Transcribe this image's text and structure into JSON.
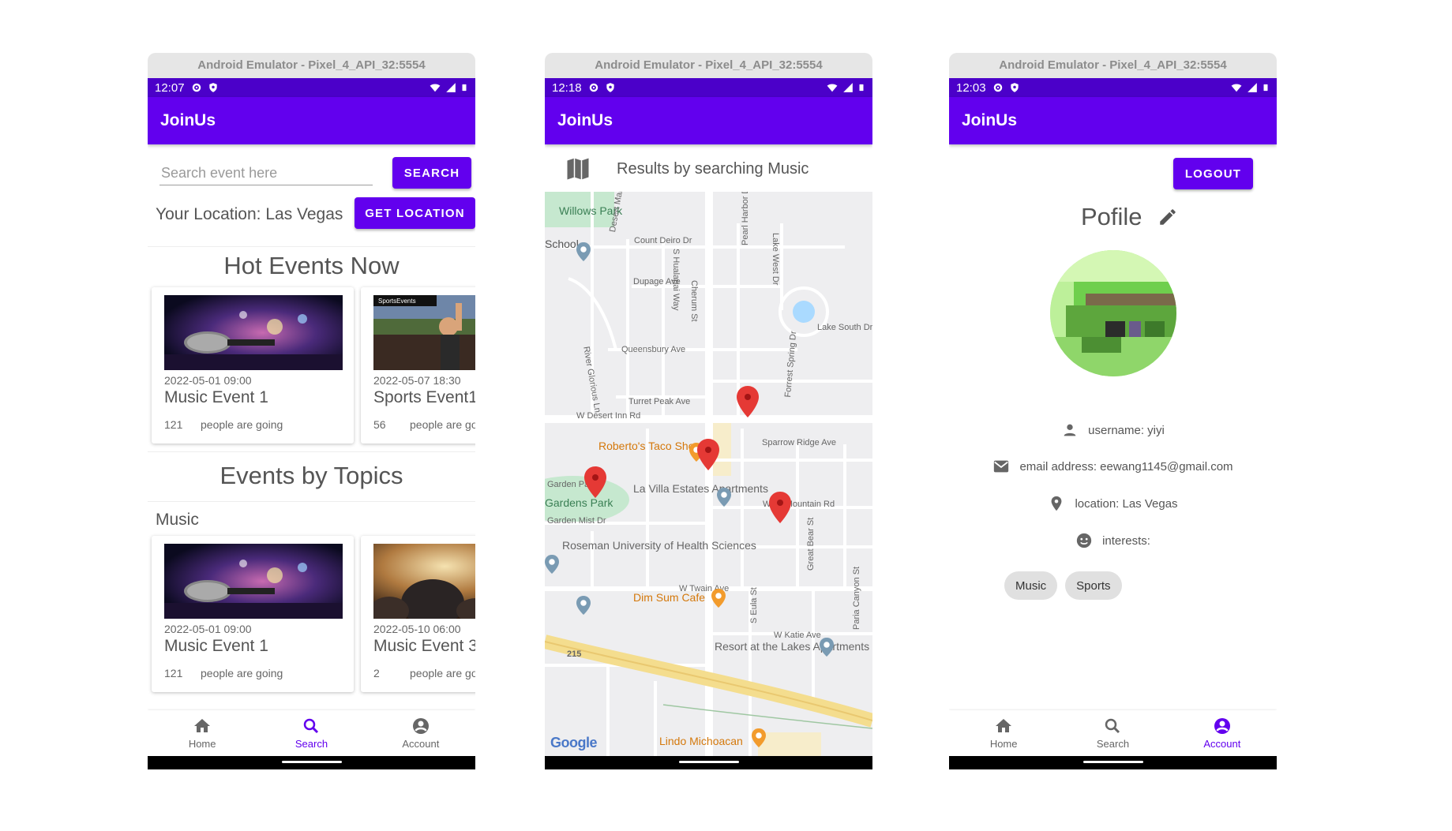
{
  "emulator_title": "Android Emulator - Pixel_4_API_32:5554",
  "app_name": "JoinUs",
  "colors": {
    "primary": "#6200ee",
    "status_bar": "#4b00c9",
    "pin": "#e53935"
  },
  "phone1": {
    "status_time": "12:07",
    "search": {
      "placeholder": "Search event here",
      "button": "SEARCH"
    },
    "location": {
      "text": "Your Location: Las Vegas",
      "button": "GET LOCATION"
    },
    "hot_title": "Hot Events Now",
    "hot_events": [
      {
        "date": "2022-05-01 09:00",
        "name": "Music Event 1",
        "count": "121",
        "going": "people are going",
        "image": "microphone-stage-image"
      },
      {
        "date": "2022-05-07 18:30",
        "name": "Sports Event1",
        "count": "56",
        "going": "people are going",
        "image": "stadium-crowd-image"
      }
    ],
    "topics_title": "Events by Topics",
    "topic_name": "Music",
    "topic_events": [
      {
        "date": "2022-05-01 09:00",
        "name": "Music Event 1",
        "count": "121",
        "going": "people are going",
        "image": "microphone-stage-image"
      },
      {
        "date": "2022-05-10 06:00",
        "name": "Music Event 3",
        "count": "2",
        "going": "people are going",
        "image": "concert-crowd-image"
      }
    ],
    "nav": {
      "home": "Home",
      "search": "Search",
      "account": "Account",
      "active": "search"
    }
  },
  "phone2": {
    "status_time": "12:18",
    "results_text": "Results by searching Music",
    "map_labels": {
      "willows_park": "Willows Park",
      "school": "School",
      "count_deiro": "Count Deiro Dr",
      "dupage": "Dupage Ave",
      "queensbury": "Queensbury Ave",
      "turret_peak": "Turret Peak Ave",
      "desert_inn": "W Desert Inn Rd",
      "sparrow_ridge": "Sparrow Ridge Ave",
      "lake_south": "Lake South Dr",
      "robertos": "Roberto's Taco Sho",
      "la_villa": "La Villa Estates Apartments",
      "gardens_park": "Gardens Park",
      "garden_mist": "Garden Mist Dr",
      "garden_pa": "Garden Pa",
      "roseman": "Roseman University of Health Sciences",
      "twain": "W Twain Ave",
      "dim_sum": "Dim Sum Cafe",
      "mountain_rd": "W    ng Mountain Rd",
      "katie": "W Katie Ave",
      "resort": "Resort at the Lakes Apartments",
      "lindo": "Lindo Michoacan",
      "hwy": "215",
      "s_hualapai": "S Hualapai Way",
      "pearl_harbor": "Pearl Harbor Dr",
      "lake_west": "Lake West Dr",
      "desert_marigold": "Desert Marigold Ln",
      "cherum": "Cherum St",
      "river_glorious": "River Glorious Ln",
      "forrest_spring": "Forrest Spring Dr",
      "great_bear": "Great Bear St",
      "s_eula": "S Eula St",
      "paria_canyon": "Paria Canyon St",
      "google": "Google"
    }
  },
  "phone3": {
    "status_time": "12:03",
    "logout": "LOGOUT",
    "profile_title": "Pofile",
    "username": "username: yiyi",
    "email": "email address: eewang1145@gmail.com",
    "location": "location: Las Vegas",
    "interests_label": "interests:",
    "interests": [
      "Music",
      "Sports"
    ],
    "nav": {
      "home": "Home",
      "search": "Search",
      "account": "Account",
      "active": "account"
    }
  }
}
